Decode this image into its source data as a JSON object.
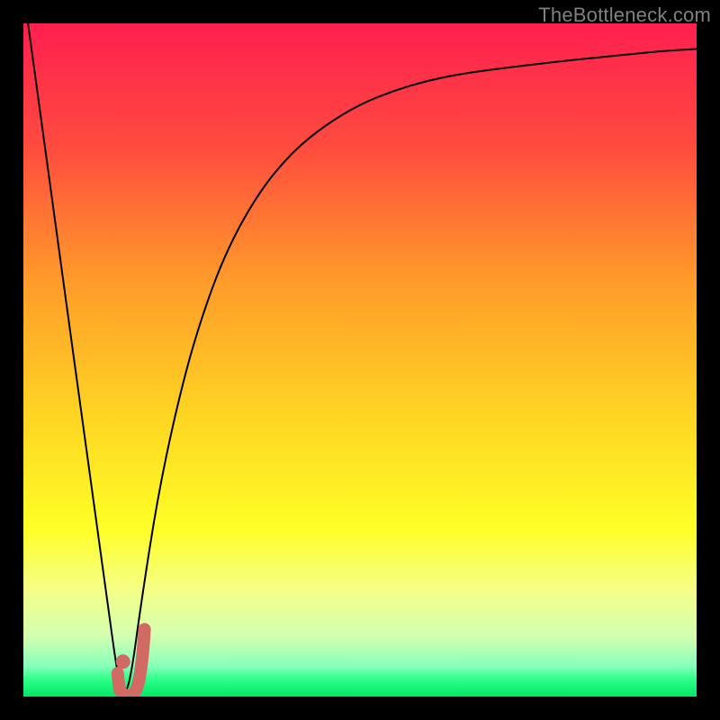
{
  "watermark": "TheBottleneck.com",
  "chart_data": {
    "type": "line",
    "x": [
      0.0,
      0.05,
      0.1,
      0.125,
      0.14,
      0.15,
      0.16,
      0.175,
      0.2,
      0.23,
      0.26,
      0.3,
      0.35,
      0.4,
      0.45,
      0.5,
      0.55,
      0.6,
      0.65,
      0.7,
      0.75,
      0.8,
      0.85,
      0.9,
      0.95,
      1.0
    ],
    "series": [
      {
        "name": "bottleneck-curve",
        "values": [
          1.05,
          0.685,
          0.32,
          0.14,
          0.03,
          0.0,
          0.03,
          0.14,
          0.3,
          0.44,
          0.55,
          0.66,
          0.75,
          0.81,
          0.85,
          0.88,
          0.9,
          0.915,
          0.925,
          0.932,
          0.938,
          0.944,
          0.949,
          0.954,
          0.959,
          0.962
        ],
        "stroke": "#000000",
        "stroke_width_px": 2
      }
    ],
    "marker": {
      "name": "recommended-point",
      "x": 0.148,
      "y": 0.012,
      "hook_end_x": 0.18,
      "hook_end_y": 0.1,
      "color": "#d16a63",
      "stroke_width_px": 14
    },
    "background_gradient": {
      "stops": [
        {
          "pos": 0.0,
          "color": "#ff1f4f"
        },
        {
          "pos": 0.18,
          "color": "#ff4a3f"
        },
        {
          "pos": 0.38,
          "color": "#ff9a2a"
        },
        {
          "pos": 0.58,
          "color": "#ffd423"
        },
        {
          "pos": 0.75,
          "color": "#feff26"
        },
        {
          "pos": 0.84,
          "color": "#f6ff86"
        },
        {
          "pos": 0.91,
          "color": "#d3ffb0"
        },
        {
          "pos": 0.955,
          "color": "#86ffba"
        },
        {
          "pos": 0.975,
          "color": "#2bff88"
        },
        {
          "pos": 1.0,
          "color": "#00e765"
        }
      ]
    },
    "title": "",
    "xlabel": "",
    "ylabel": "",
    "xlim": [
      0,
      1
    ],
    "ylim": [
      0,
      1
    ],
    "grid": false,
    "legend": false
  }
}
